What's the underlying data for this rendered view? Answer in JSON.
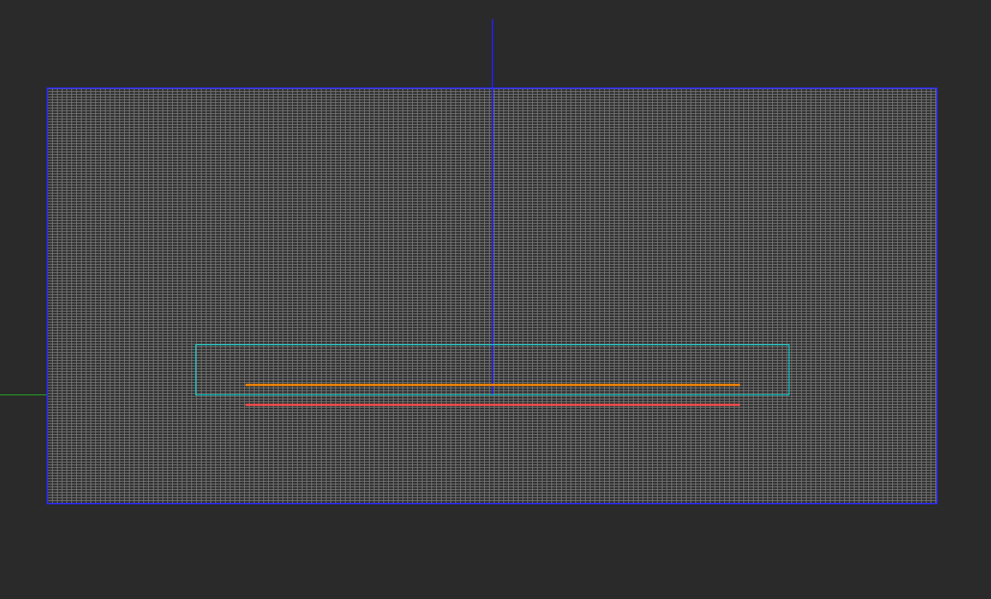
{
  "colors": {
    "background": "#2a2a2a",
    "grid_line": "#7a7a7a",
    "grid_fill": "#333333",
    "frame_border": "#2b2bff",
    "vertical_axis": "#2020ff",
    "horizontal_axis_left": "#22cc22",
    "bounds_rect": "#00e5e5",
    "orange_line": "#ff8800",
    "red_line": "#ff4d4d"
  }
}
